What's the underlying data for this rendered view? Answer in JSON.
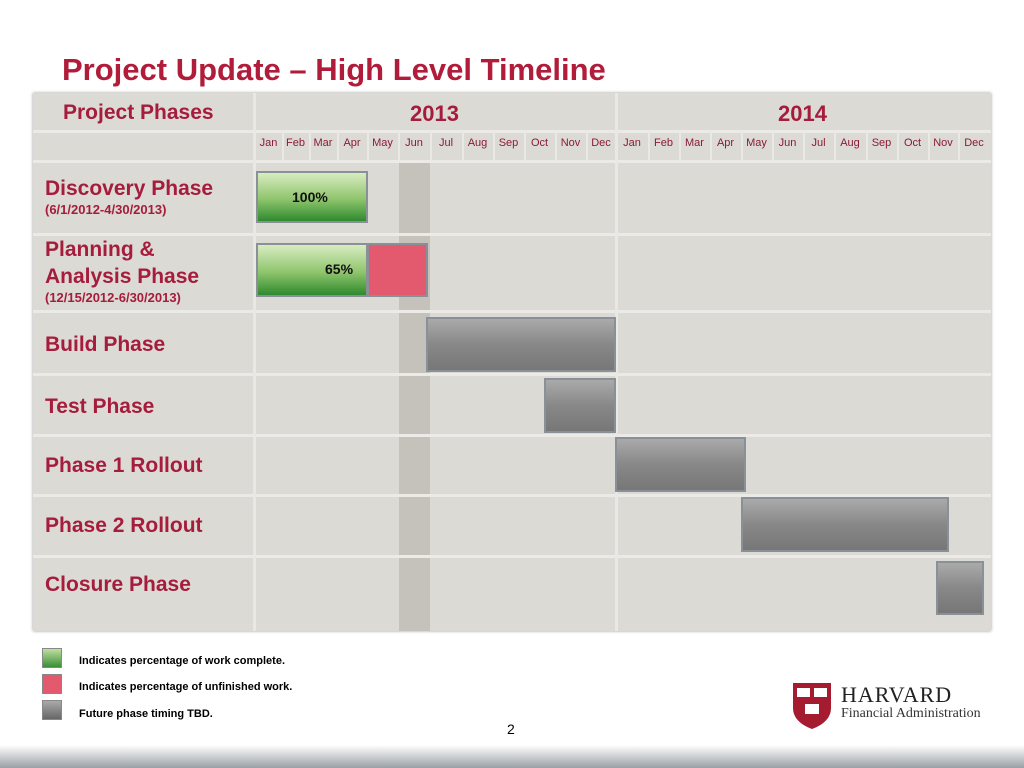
{
  "title": "Project Update – High Level Timeline",
  "header": {
    "phases_label": "Project Phases",
    "year1": "2013",
    "year2": "2014"
  },
  "months": [
    "Jan",
    "Feb",
    "Mar",
    "Apr",
    "May",
    "Jun",
    "Jul",
    "Aug",
    "Sep",
    "Oct",
    "Nov",
    "Dec",
    "Jan",
    "Feb",
    "Mar",
    "Apr",
    "May",
    "Jun",
    "Jul",
    "Aug",
    "Sep",
    "Oct",
    "Nov",
    "Dec"
  ],
  "phases": [
    {
      "name": "Discovery Phase",
      "dates": "(6/1/2012-4/30/2013)",
      "percent": "100%"
    },
    {
      "name": "Planning & Analysis Phase",
      "dates": "(12/15/2012-6/30/2013)",
      "percent": "65%"
    },
    {
      "name": "Build Phase"
    },
    {
      "name": "Test Phase"
    },
    {
      "name": "Phase 1 Rollout"
    },
    {
      "name": "Phase 2 Rollout"
    },
    {
      "name": "Closure Phase"
    }
  ],
  "legend": [
    {
      "text": "Indicates percentage of work complete.",
      "color": "#5fa84a"
    },
    {
      "text": "Indicates percentage of unfinished work.",
      "color": "#e35a6e"
    },
    {
      "text": "Future phase timing TBD.",
      "color": "#808080"
    }
  ],
  "page_number": "2",
  "logo": {
    "name": "HARVARD",
    "subtitle": "Financial Administration",
    "shield": "VE RI TAS"
  },
  "colors": {
    "accent": "#a51c3c",
    "complete": "#3a8f35",
    "unfinished": "#e35a6e",
    "tbd": "#888888"
  }
}
